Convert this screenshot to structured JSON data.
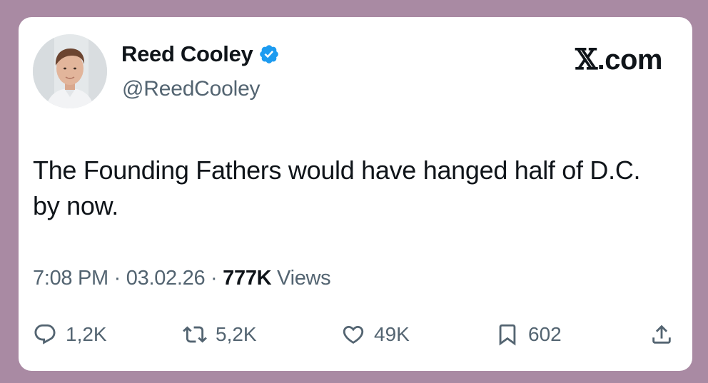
{
  "author": {
    "name": "Reed Cooley",
    "handle": "@ReedCooley",
    "verified": true
  },
  "brand": {
    "glyph": "𝕏",
    "suffix": ".com"
  },
  "tweet": {
    "text": "The Founding Fathers would have hanged half of D.C. by now."
  },
  "meta": {
    "time": "7:08 PM",
    "sep1": " · ",
    "date": "03.02.26",
    "sep2": " · ",
    "views_count": "777K",
    "views_label": " Views"
  },
  "actions": {
    "replies": "1,2K",
    "retweets": "5,2K",
    "likes": "49K",
    "bookmarks": "602"
  },
  "colors": {
    "background": "#a98aa3",
    "card": "#ffffff",
    "primary_text": "#0f1419",
    "secondary_text": "#536471",
    "verified_blue": "#1d9bf0"
  },
  "icons": {
    "verified": "verified-badge-icon",
    "reply": "reply-icon",
    "retweet": "retweet-icon",
    "like": "heart-icon",
    "bookmark": "bookmark-icon",
    "share": "share-icon"
  }
}
